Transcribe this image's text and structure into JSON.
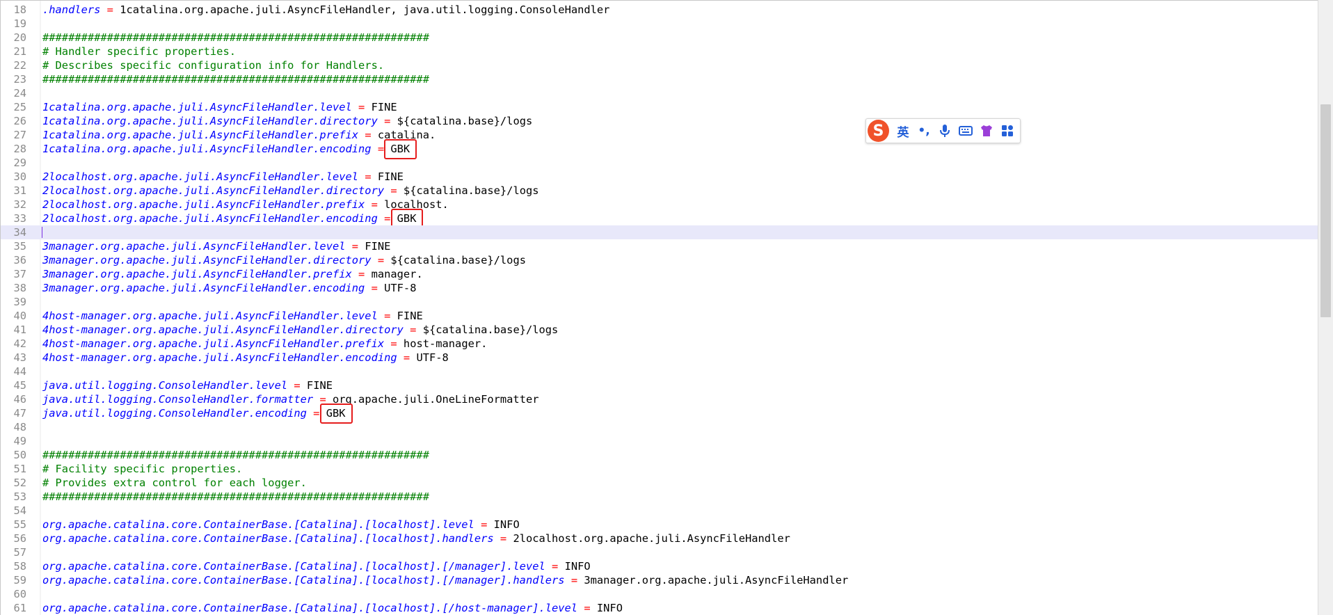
{
  "editor": {
    "current_line": 34,
    "lines": [
      {
        "n": "18",
        "segments": [
          {
            "t": "k",
            "v": ".handlers"
          },
          {
            "t": "op",
            "v": " = "
          },
          {
            "t": "v",
            "v": "1catalina.org.apache.juli.AsyncFileHandler, java.util.logging.ConsoleHandler"
          }
        ]
      },
      {
        "n": "19",
        "segments": []
      },
      {
        "n": "20",
        "segments": [
          {
            "t": "c",
            "v": "############################################################"
          }
        ]
      },
      {
        "n": "21",
        "segments": [
          {
            "t": "c",
            "v": "# Handler specific properties."
          }
        ]
      },
      {
        "n": "22",
        "segments": [
          {
            "t": "c",
            "v": "# Describes specific configuration info for Handlers."
          }
        ]
      },
      {
        "n": "23",
        "segments": [
          {
            "t": "c",
            "v": "############################################################"
          }
        ]
      },
      {
        "n": "24",
        "segments": []
      },
      {
        "n": "25",
        "segments": [
          {
            "t": "k",
            "v": "1catalina.org.apache.juli.AsyncFileHandler.level"
          },
          {
            "t": "op",
            "v": " = "
          },
          {
            "t": "v",
            "v": "FINE"
          }
        ]
      },
      {
        "n": "26",
        "segments": [
          {
            "t": "k",
            "v": "1catalina.org.apache.juli.AsyncFileHandler.directory"
          },
          {
            "t": "op",
            "v": " = "
          },
          {
            "t": "v",
            "v": "${catalina.base}/logs"
          }
        ]
      },
      {
        "n": "27",
        "segments": [
          {
            "t": "k",
            "v": "1catalina.org.apache.juli.AsyncFileHandler.prefix"
          },
          {
            "t": "op",
            "v": " = "
          },
          {
            "t": "v",
            "v": "catalina."
          }
        ]
      },
      {
        "n": "28",
        "segments": [
          {
            "t": "k",
            "v": "1catalina.org.apache.juli.AsyncFileHandler.encoding"
          },
          {
            "t": "op",
            "v": " = "
          },
          {
            "t": "hl",
            "v": "GBK"
          }
        ]
      },
      {
        "n": "29",
        "segments": []
      },
      {
        "n": "30",
        "segments": [
          {
            "t": "k",
            "v": "2localhost.org.apache.juli.AsyncFileHandler.level"
          },
          {
            "t": "op",
            "v": " = "
          },
          {
            "t": "v",
            "v": "FINE"
          }
        ]
      },
      {
        "n": "31",
        "segments": [
          {
            "t": "k",
            "v": "2localhost.org.apache.juli.AsyncFileHandler.directory"
          },
          {
            "t": "op",
            "v": " = "
          },
          {
            "t": "v",
            "v": "${catalina.base}/logs"
          }
        ]
      },
      {
        "n": "32",
        "segments": [
          {
            "t": "k",
            "v": "2localhost.org.apache.juli.AsyncFileHandler.prefix"
          },
          {
            "t": "op",
            "v": " = "
          },
          {
            "t": "v",
            "v": "localhost."
          }
        ]
      },
      {
        "n": "33",
        "segments": [
          {
            "t": "k",
            "v": "2localhost.org.apache.juli.AsyncFileHandler.encoding"
          },
          {
            "t": "op",
            "v": " = "
          },
          {
            "t": "hl",
            "v": "GBK"
          }
        ]
      },
      {
        "n": "34",
        "segments": []
      },
      {
        "n": "35",
        "segments": [
          {
            "t": "k",
            "v": "3manager.org.apache.juli.AsyncFileHandler.level"
          },
          {
            "t": "op",
            "v": " = "
          },
          {
            "t": "v",
            "v": "FINE"
          }
        ]
      },
      {
        "n": "36",
        "segments": [
          {
            "t": "k",
            "v": "3manager.org.apache.juli.AsyncFileHandler.directory"
          },
          {
            "t": "op",
            "v": " = "
          },
          {
            "t": "v",
            "v": "${catalina.base}/logs"
          }
        ]
      },
      {
        "n": "37",
        "segments": [
          {
            "t": "k",
            "v": "3manager.org.apache.juli.AsyncFileHandler.prefix"
          },
          {
            "t": "op",
            "v": " = "
          },
          {
            "t": "v",
            "v": "manager."
          }
        ]
      },
      {
        "n": "38",
        "segments": [
          {
            "t": "k",
            "v": "3manager.org.apache.juli.AsyncFileHandler.encoding"
          },
          {
            "t": "op",
            "v": " = "
          },
          {
            "t": "v",
            "v": "UTF-8"
          }
        ]
      },
      {
        "n": "39",
        "segments": []
      },
      {
        "n": "40",
        "segments": [
          {
            "t": "k",
            "v": "4host-manager.org.apache.juli.AsyncFileHandler.level"
          },
          {
            "t": "op",
            "v": " = "
          },
          {
            "t": "v",
            "v": "FINE"
          }
        ]
      },
      {
        "n": "41",
        "segments": [
          {
            "t": "k",
            "v": "4host-manager.org.apache.juli.AsyncFileHandler.directory"
          },
          {
            "t": "op",
            "v": " = "
          },
          {
            "t": "v",
            "v": "${catalina.base}/logs"
          }
        ]
      },
      {
        "n": "42",
        "segments": [
          {
            "t": "k",
            "v": "4host-manager.org.apache.juli.AsyncFileHandler.prefix"
          },
          {
            "t": "op",
            "v": " = "
          },
          {
            "t": "v",
            "v": "host-manager."
          }
        ]
      },
      {
        "n": "43",
        "segments": [
          {
            "t": "k",
            "v": "4host-manager.org.apache.juli.AsyncFileHandler.encoding"
          },
          {
            "t": "op",
            "v": " = "
          },
          {
            "t": "v",
            "v": "UTF-8"
          }
        ]
      },
      {
        "n": "44",
        "segments": []
      },
      {
        "n": "45",
        "segments": [
          {
            "t": "k",
            "v": "java.util.logging.ConsoleHandler.level"
          },
          {
            "t": "op",
            "v": " = "
          },
          {
            "t": "v",
            "v": "FINE"
          }
        ]
      },
      {
        "n": "46",
        "segments": [
          {
            "t": "k",
            "v": "java.util.logging.ConsoleHandler.formatter"
          },
          {
            "t": "op",
            "v": " = "
          },
          {
            "t": "v",
            "v": "org.apache.juli.OneLineFormatter"
          }
        ]
      },
      {
        "n": "47",
        "segments": [
          {
            "t": "k",
            "v": "java.util.logging.ConsoleHandler.encoding"
          },
          {
            "t": "op",
            "v": " = "
          },
          {
            "t": "hl",
            "v": "GBK"
          }
        ]
      },
      {
        "n": "48",
        "segments": []
      },
      {
        "n": "49",
        "segments": []
      },
      {
        "n": "50",
        "segments": [
          {
            "t": "c",
            "v": "############################################################"
          }
        ]
      },
      {
        "n": "51",
        "segments": [
          {
            "t": "c",
            "v": "# Facility specific properties."
          }
        ]
      },
      {
        "n": "52",
        "segments": [
          {
            "t": "c",
            "v": "# Provides extra control for each logger."
          }
        ]
      },
      {
        "n": "53",
        "segments": [
          {
            "t": "c",
            "v": "############################################################"
          }
        ]
      },
      {
        "n": "54",
        "segments": []
      },
      {
        "n": "55",
        "segments": [
          {
            "t": "k",
            "v": "org.apache.catalina.core.ContainerBase.[Catalina].[localhost].level"
          },
          {
            "t": "op",
            "v": " = "
          },
          {
            "t": "v",
            "v": "INFO"
          }
        ]
      },
      {
        "n": "56",
        "segments": [
          {
            "t": "k",
            "v": "org.apache.catalina.core.ContainerBase.[Catalina].[localhost].handlers"
          },
          {
            "t": "op",
            "v": " = "
          },
          {
            "t": "v",
            "v": "2localhost.org.apache.juli.AsyncFileHandler"
          }
        ]
      },
      {
        "n": "57",
        "segments": []
      },
      {
        "n": "58",
        "segments": [
          {
            "t": "k",
            "v": "org.apache.catalina.core.ContainerBase.[Catalina].[localhost].[/manager].level"
          },
          {
            "t": "op",
            "v": " = "
          },
          {
            "t": "v",
            "v": "INFO"
          }
        ]
      },
      {
        "n": "59",
        "segments": [
          {
            "t": "k",
            "v": "org.apache.catalina.core.ContainerBase.[Catalina].[localhost].[/manager].handlers"
          },
          {
            "t": "op",
            "v": " = "
          },
          {
            "t": "v",
            "v": "3manager.org.apache.juli.AsyncFileHandler"
          }
        ]
      },
      {
        "n": "60",
        "segments": []
      },
      {
        "n": "61",
        "segments": [
          {
            "t": "k",
            "v": "org.apache.catalina.core.ContainerBase.[Catalina].[localhost].[/host-manager].level"
          },
          {
            "t": "op",
            "v": " = "
          },
          {
            "t": "v",
            "v": "INFO"
          }
        ]
      }
    ]
  },
  "ime_toolbar": {
    "logo_letter": "S",
    "lang_label": "英",
    "punct_label": "•,",
    "icons": [
      "microphone-icon",
      "keyboard-icon",
      "shirt-icon",
      "apps-grid-icon"
    ]
  },
  "scrollbar": {
    "thumb_fraction": 0.35
  },
  "colors": {
    "key": "#0000ff",
    "operator": "#ff0000",
    "comment": "#008000",
    "annotation": "#e51c1c",
    "ime_accent": "#f0522a"
  }
}
